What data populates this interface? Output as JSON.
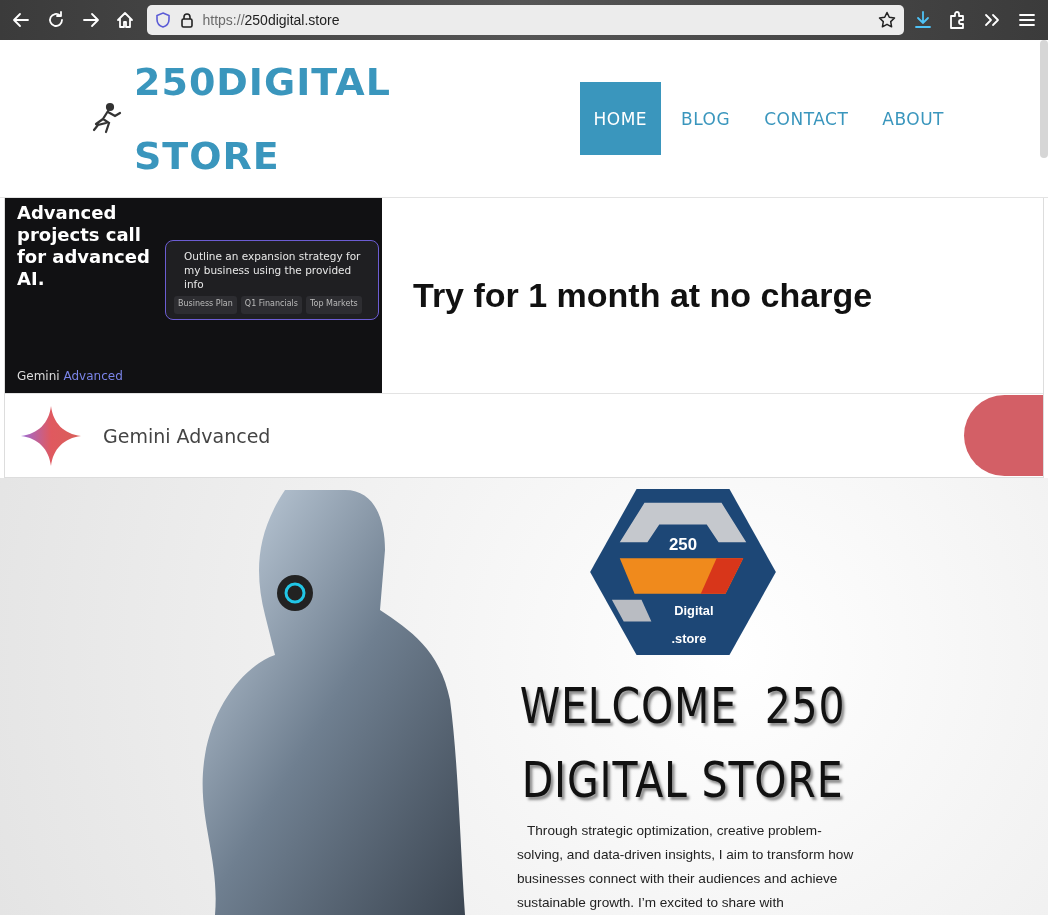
{
  "browser": {
    "url_prefix": "https://",
    "url_host": "250digital.store"
  },
  "site": {
    "title_lines": [
      "250DIGITAL",
      "STORE"
    ],
    "nav": [
      {
        "label": "HOME",
        "selected": true
      },
      {
        "label": "BLOG",
        "selected": false
      },
      {
        "label": "CONTACT",
        "selected": false
      },
      {
        "label": "ABOUT",
        "selected": false
      }
    ]
  },
  "ad": {
    "image_headline": "Advanced projects call for advanced AI.",
    "image_prompt": "Outline an expansion strategy for my business using the provided info",
    "image_chips": [
      "Business Plan",
      "Q1 Financials",
      "Top Markets"
    ],
    "image_brand": "Gemini",
    "image_brand_accent": "Advanced",
    "headline": "Try for 1 month at no charge",
    "advertiser": "Gemini Advanced"
  },
  "hero": {
    "logo_lines": [
      "250",
      "Digital",
      ".store"
    ],
    "title_lines": [
      "WELCOME  250",
      "DIGITAL STORE"
    ],
    "paragraph": "Through strategic optimization, creative problem-solving, and data-driven insights, I aim to transform how businesses connect with their audiences and achieve sustainable growth. I’m excited to share with"
  }
}
